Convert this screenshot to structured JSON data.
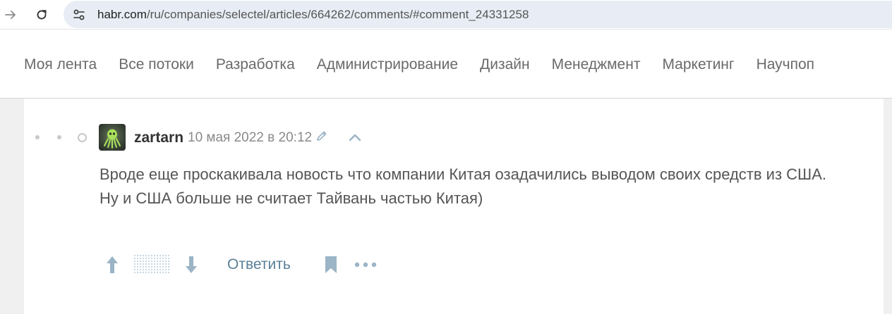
{
  "browser": {
    "url_domain": "habr.com",
    "url_path": "/ru/companies/selectel/articles/664262/comments/#comment_24331258"
  },
  "nav": {
    "flows": [
      "Моя лента",
      "Все потоки",
      "Разработка",
      "Администрирование",
      "Дизайн",
      "Менеджмент",
      "Маркетинг",
      "Научпоп"
    ]
  },
  "comment": {
    "username": "zartarn",
    "timestamp": "10 мая 2022 в 20:12",
    "body_line1": "Вроде еще проскакивала новость что компании Китая озадачились выводом своих средств из США.",
    "body_line2": "Ну и США больше не считает Тайвань частью Китая)",
    "reply_label": "Ответить"
  },
  "colors": {
    "link": "#5a7f98",
    "icon": "#8fa8bb",
    "text": "#555555"
  },
  "icons": {
    "forward": "arrow-right-icon",
    "reload": "reload-icon",
    "site_settings": "site-settings-icon",
    "edit": "pencil-icon",
    "parent": "chevron-up-icon",
    "vote_up": "arrow-up-icon",
    "vote_down": "arrow-down-icon",
    "bookmark": "bookmark-icon",
    "more": "more-dots-icon"
  }
}
